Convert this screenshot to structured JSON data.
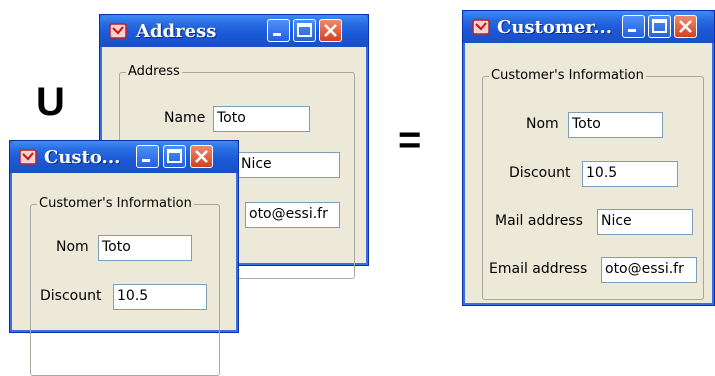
{
  "operators": {
    "union": "U",
    "equals": "="
  },
  "address_window": {
    "title": "Address",
    "group_title": "Address",
    "name_label": "Name",
    "name_value": "Toto",
    "city_value": "Nice",
    "email_value": "oto@essi.fr"
  },
  "customer_small_window": {
    "title": "Custo...",
    "group_title": "Customer's Information",
    "nom_label": "Nom",
    "nom_value": "Toto",
    "discount_label": "Discount",
    "discount_value": "10.5"
  },
  "customer_result_window": {
    "title": "Customer...",
    "group_title": "Customer's Information",
    "nom_label": "Nom",
    "nom_value": "Toto",
    "discount_label": "Discount",
    "discount_value": "10.5",
    "mail_label": "Mail address",
    "mail_value": "Nice",
    "email_label": "Email address",
    "email_value": "oto@essi.fr"
  },
  "colors": {
    "titlebar": "#2869e0",
    "window_bg": "#ece9d8",
    "close_button": "#d2401e"
  },
  "icons": [
    "app-icon",
    "minimize-icon",
    "maximize-icon",
    "close-icon"
  ]
}
